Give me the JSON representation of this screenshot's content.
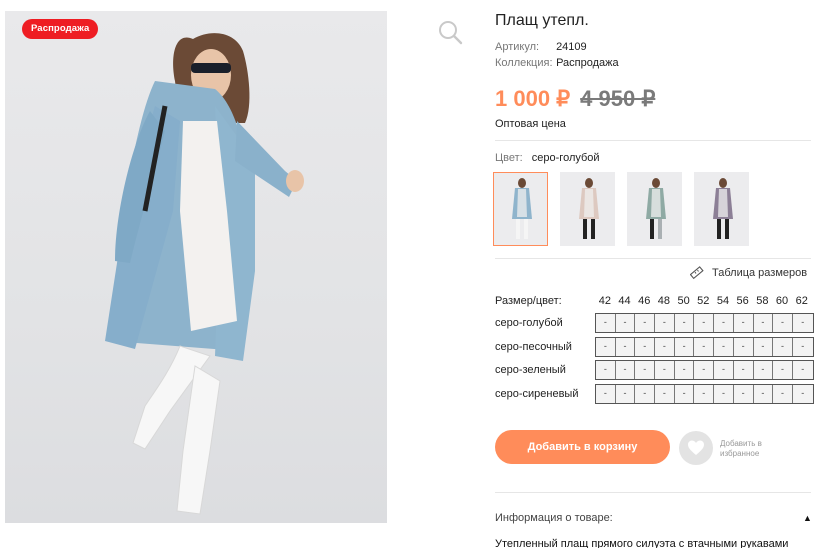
{
  "badge": "Распродажа",
  "product": {
    "title": "Плащ утепл.",
    "article_label": "Артикул:",
    "article_value": "24109",
    "collection_label": "Коллекция:",
    "collection_value": "Распродажа",
    "price_new": "1 000 ₽",
    "price_old": "4 950 ₽",
    "price_note": "Оптовая цена",
    "color_label": "Цвет:",
    "color_value": "серо-голубой"
  },
  "swatches": [
    {
      "name": "серо-голубой",
      "coat": "#8fb4cc",
      "active": true
    },
    {
      "name": "серо-песочный",
      "coat": "#ddc9c0",
      "active": false
    },
    {
      "name": "серо-зеленый",
      "coat": "#8faaa4",
      "active": false
    },
    {
      "name": "серо-сиреневый",
      "coat": "#8c7f96",
      "active": false
    }
  ],
  "size_table_link": "Таблица размеров",
  "size_grid": {
    "header_label": "Размер/цвет:",
    "sizes": [
      "42",
      "44",
      "46",
      "48",
      "50",
      "52",
      "54",
      "56",
      "58",
      "60",
      "62"
    ],
    "rows": [
      {
        "color": "серо-голубой",
        "values": [
          "-",
          "-",
          "-",
          "-",
          "-",
          "-",
          "-",
          "-",
          "-",
          "-",
          "-"
        ]
      },
      {
        "color": "серо-песочный",
        "values": [
          "-",
          "-",
          "-",
          "-",
          "-",
          "-",
          "-",
          "-",
          "-",
          "-",
          "-"
        ]
      },
      {
        "color": "серо-зеленый",
        "values": [
          "-",
          "-",
          "-",
          "-",
          "-",
          "-",
          "-",
          "-",
          "-",
          "-",
          "-"
        ]
      },
      {
        "color": "серо-сиреневый",
        "values": [
          "-",
          "-",
          "-",
          "-",
          "-",
          "-",
          "-",
          "-",
          "-",
          "-",
          "-"
        ]
      }
    ]
  },
  "actions": {
    "add_to_cart": "Добавить в корзину",
    "favorite_line1": "Добавить в",
    "favorite_line2": "избранное"
  },
  "info": {
    "heading": "Информация о товаре:",
    "toggle": "▲",
    "description": "Утепленный плащ прямого силуэта с втачными рукавами"
  },
  "colors": {
    "accent": "#ff8c5a",
    "badge": "#ee1d23"
  },
  "icons": [
    "search-icon",
    "ruler-icon",
    "heart-icon",
    "collapse-arrow-icon"
  ]
}
